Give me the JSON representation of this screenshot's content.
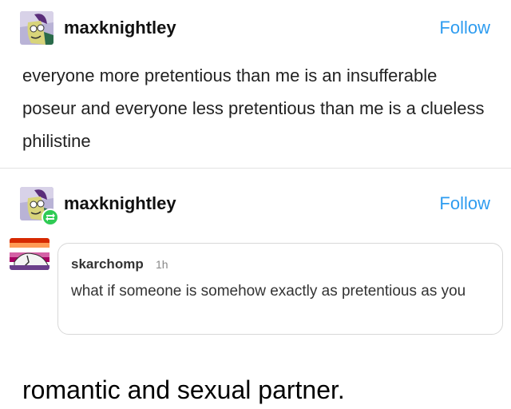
{
  "post1": {
    "username": "maxknightley",
    "follow_label": "Follow",
    "body": "everyone more pretentious than me is an insufferable poseur and everyone less pretentious than me is a clueless philistine"
  },
  "post2": {
    "username": "maxknightley",
    "follow_label": "Follow",
    "ask": {
      "username": "skarchomp",
      "time": "1h",
      "text": "what if someone is somehow exactly as pretentious as you"
    },
    "caption": "romantic and sexual partner."
  },
  "colors": {
    "follow": "#2e9cf0",
    "reblog_badge": "#2fcb54"
  },
  "icons": {
    "avatar": "avatar-icon",
    "reblog": "reblog-icon"
  }
}
